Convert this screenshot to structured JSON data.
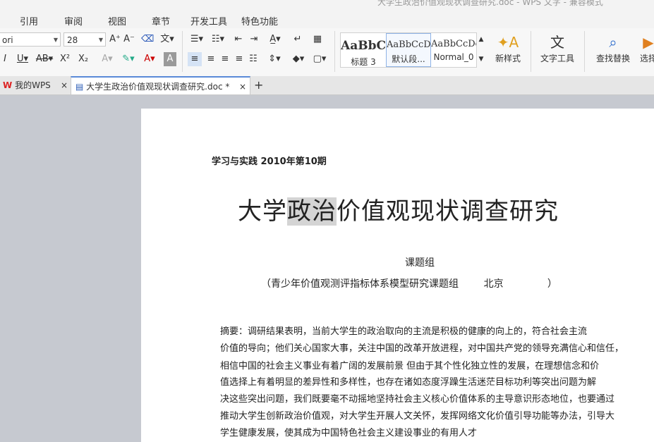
{
  "window": {
    "title": "大学生政治价值观现状调查研究.doc - WPS 文字 - 兼容模式"
  },
  "menu": [
    "引用",
    "审阅",
    "视图",
    "章节",
    "开发工具",
    "特色功能"
  ],
  "ribbon": {
    "font_name": "ori",
    "font_size": "28",
    "styles": [
      {
        "preview": "AaBbC",
        "name": "标题 3"
      },
      {
        "preview": "AaBbCcDc",
        "name": "默认段..."
      },
      {
        "preview": "AaBbCcDc",
        "name": "Normal_0"
      }
    ],
    "new_style_label": "新样式",
    "text_tools_label": "文字工具",
    "find_replace_label": "查找替换",
    "select_label": "选择"
  },
  "tabs": [
    {
      "label": "我的WPS",
      "active": false
    },
    {
      "label": "大学生政治价值观现状调查研究.doc *",
      "active": true
    }
  ],
  "document": {
    "journal": "学习与实践 2010年第10期",
    "title_before": "大学",
    "title_highlight": "政治",
    "title_after": "价值观现状调查研究",
    "group": "课题组",
    "affiliation": "（青少年价值观测评指标体系模型研究课题组        北京              ）",
    "abstract_lines": [
      "    摘要：调研结果表明，当前大学生的政治取向的主流是积极的健康的向上的，符合社会主流",
      "价值的导向；他们关心国家大事，关注中国的改革开放进程，对中国共产党的领导充满信心和信任，",
      "相信中国的社会主义事业有着广阔的发展前景    但由于其个性化独立性的发展，在理想信念和价",
      "值选择上有着明显的差异性和多样性，也存在诸如态度浮躁生活迷茫目标功利等突出问题为解",
      "决这些突出问题，我们既要毫不动摇地坚持社会主义核心价值体系的主导意识形态地位，也要通过",
      "推动大学生创新政治价值观，对大学生开展人文关怀，发挥网络文化价值引导功能等办法，引导大",
      "学生健康发展，使其成为中国特色社会主义建设事业的有用人才"
    ]
  }
}
